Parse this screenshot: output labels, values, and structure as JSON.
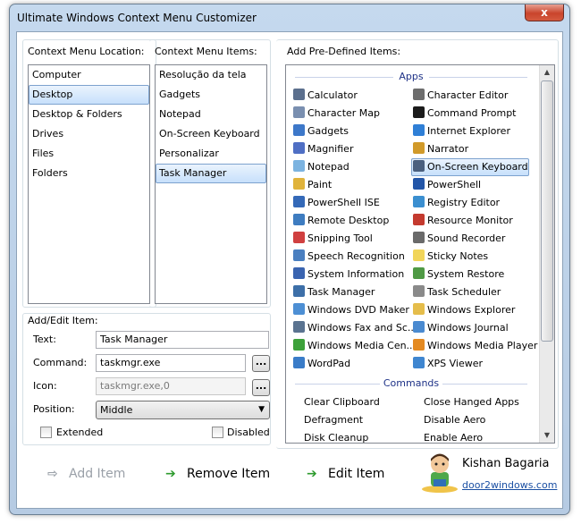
{
  "window": {
    "title": "Ultimate Windows Context Menu Customizer",
    "close_glyph": "x"
  },
  "location": {
    "label": "Context Menu Location:",
    "items": [
      "Computer",
      "Desktop",
      "Desktop & Folders",
      "Drives",
      "Files",
      "Folders"
    ],
    "selected": "Desktop"
  },
  "menu_items": {
    "label": "Context Menu Items:",
    "items": [
      "Resolução da tela",
      "Gadgets",
      "Notepad",
      "On-Screen Keyboard",
      "Personalizar",
      "Task Manager"
    ],
    "selected": "Task Manager"
  },
  "edit": {
    "label": "Add/Edit Item:",
    "text_label": "Text:",
    "text_value": "Task Manager",
    "command_label": "Command:",
    "command_value": "taskmgr.exe",
    "icon_label": "Icon:",
    "icon_value": "taskmgr.exe,0",
    "browse_label": "...",
    "position_label": "Position:",
    "position_value": "Middle",
    "extended_label": "Extended",
    "extended_checked": false,
    "disabled_label": "Disabled",
    "disabled_checked": false
  },
  "predefined": {
    "label": "Add Pre-Defined Items:",
    "apps_heading": "Apps",
    "apps": [
      {
        "label": "Calculator",
        "icon": "calculator-icon",
        "color": "#5b6f8d"
      },
      {
        "label": "Character Editor",
        "icon": "character-editor-icon",
        "color": "#6d6d6d"
      },
      {
        "label": "Character Map",
        "icon": "character-map-icon",
        "color": "#7a8fb0"
      },
      {
        "label": "Command Prompt",
        "icon": "command-prompt-icon",
        "color": "#1b1b1b"
      },
      {
        "label": "Gadgets",
        "icon": "gadgets-icon",
        "color": "#3d78c9"
      },
      {
        "label": "Internet Explorer",
        "icon": "internet-explorer-icon",
        "color": "#2f7fd6"
      },
      {
        "label": "Magnifier",
        "icon": "magnifier-icon",
        "color": "#4f6fc4"
      },
      {
        "label": "Narrator",
        "icon": "narrator-icon",
        "color": "#d19a2a"
      },
      {
        "label": "Notepad",
        "icon": "notepad-icon",
        "color": "#7cb3e0"
      },
      {
        "label": "On-Screen Keyboard",
        "icon": "keyboard-icon",
        "color": "#4a5f7e"
      },
      {
        "label": "Paint",
        "icon": "paint-icon",
        "color": "#e0b33b"
      },
      {
        "label": "PowerShell",
        "icon": "powershell-icon",
        "color": "#2356a8"
      },
      {
        "label": "PowerShell ISE",
        "icon": "powershell-ise-icon",
        "color": "#3469b8"
      },
      {
        "label": "Registry Editor",
        "icon": "registry-editor-icon",
        "color": "#3b8fd0"
      },
      {
        "label": "Remote Desktop",
        "icon": "remote-desktop-icon",
        "color": "#3e7cc0"
      },
      {
        "label": "Resource Monitor",
        "icon": "resource-monitor-icon",
        "color": "#c43a2f"
      },
      {
        "label": "Snipping Tool",
        "icon": "snipping-tool-icon",
        "color": "#d04040"
      },
      {
        "label": "Sound Recorder",
        "icon": "sound-recorder-icon",
        "color": "#6a6a6a"
      },
      {
        "label": "Speech Recognition",
        "icon": "speech-recognition-icon",
        "color": "#4a7fc0"
      },
      {
        "label": "Sticky Notes",
        "icon": "sticky-notes-icon",
        "color": "#f1d55a"
      },
      {
        "label": "System Information",
        "icon": "system-information-icon",
        "color": "#3a64b0"
      },
      {
        "label": "System Restore",
        "icon": "system-restore-icon",
        "color": "#4f9a45"
      },
      {
        "label": "Task Manager",
        "icon": "task-manager-icon",
        "color": "#3d6fa8"
      },
      {
        "label": "Task Scheduler",
        "icon": "task-scheduler-icon",
        "color": "#8a8a8a"
      },
      {
        "label": "Windows DVD Maker",
        "icon": "dvd-maker-icon",
        "color": "#4d8fd4"
      },
      {
        "label": "Windows Explorer",
        "icon": "windows-explorer-icon",
        "color": "#e5bd4b"
      },
      {
        "label": "Windows Fax and Sc...",
        "icon": "fax-scan-icon",
        "color": "#5a7390"
      },
      {
        "label": "Windows Journal",
        "icon": "windows-journal-icon",
        "color": "#4a8ad0"
      },
      {
        "label": "Windows Media Cen...",
        "icon": "media-center-icon",
        "color": "#3da13a"
      },
      {
        "label": "Windows Media Player",
        "icon": "media-player-icon",
        "color": "#e48a22"
      },
      {
        "label": "WordPad",
        "icon": "wordpad-icon",
        "color": "#3a7cc8"
      },
      {
        "label": "XPS Viewer",
        "icon": "xps-viewer-icon",
        "color": "#3f86d0"
      }
    ],
    "selected": "On-Screen Keyboard",
    "commands_heading": "Commands",
    "commands": [
      "Clear Clipboard",
      "Close Hanged Apps",
      "Defragment",
      "Disable Aero",
      "Disk Cleanup",
      "Enable Aero"
    ]
  },
  "actions": {
    "add": "Add Item",
    "remove": "Remove Item",
    "edit": "Edit Item"
  },
  "author": {
    "name": "Kishan Bagaria",
    "link": "door2windows.com"
  }
}
